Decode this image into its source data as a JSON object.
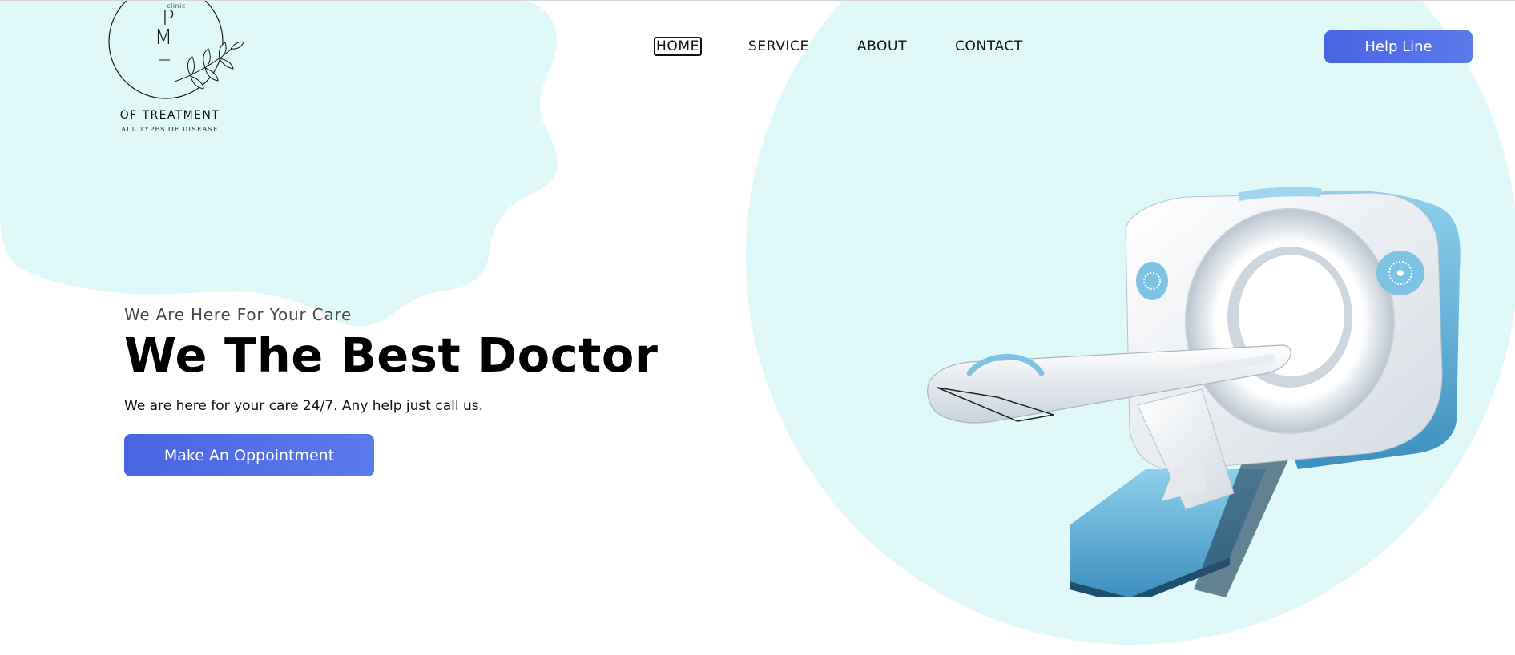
{
  "logo": {
    "small_text": "clinic",
    "monogram_top": "P",
    "monogram_bottom": "M",
    "title": "OF TREATMENT",
    "subtitle": "ALL TYPES OF  DISEASE"
  },
  "nav": {
    "items": [
      {
        "label": "HOME",
        "active": true
      },
      {
        "label": "SERVICE",
        "active": false
      },
      {
        "label": "ABOUT",
        "active": false
      },
      {
        "label": "CONTACT",
        "active": false
      }
    ]
  },
  "header": {
    "help_button": "Help Line"
  },
  "hero": {
    "kicker": "We Are Here For Your Care",
    "title": "We The Best Doctor",
    "text": "We are here for your care 24/7. Any help just call us.",
    "cta": "Make An Oppointment"
  },
  "colors": {
    "accent": "#4f6ae4",
    "blob": "#e0f8f7",
    "text": "#111111",
    "scanner_blue": "#5fb0d8"
  },
  "icons": {
    "logo_mark": "laurel-branch-icon",
    "hero_image": "ct-scanner-illustration"
  }
}
